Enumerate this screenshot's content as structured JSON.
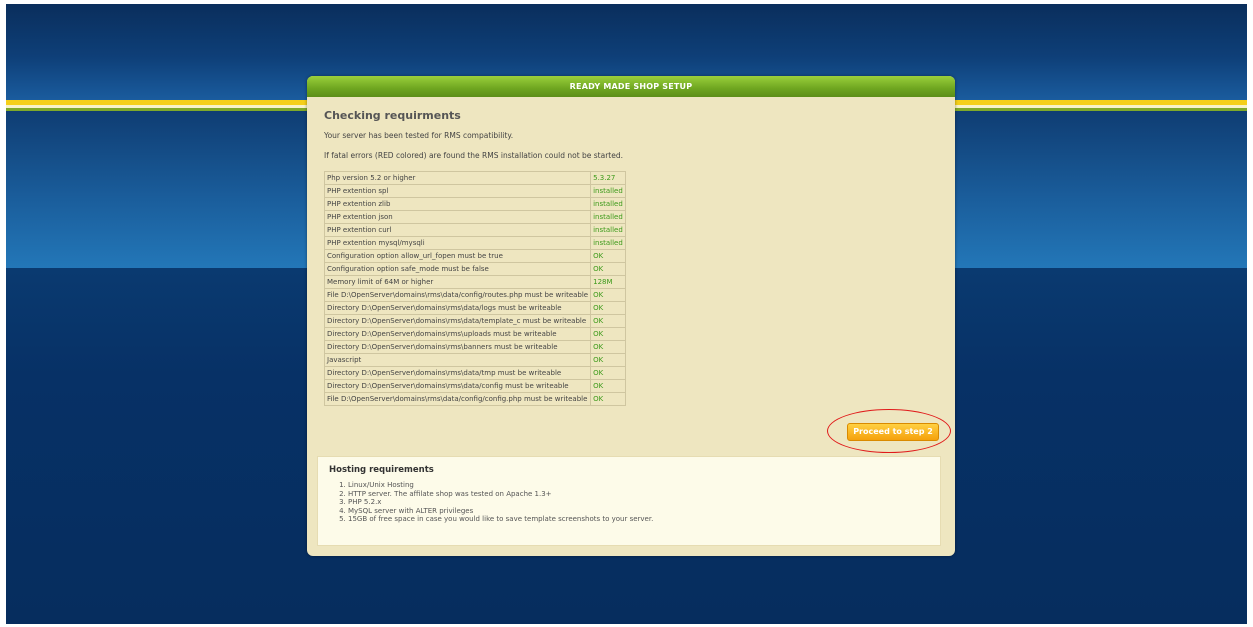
{
  "header": {
    "title": "READY MADE SHOP SETUP"
  },
  "main": {
    "title": "Checking requirments",
    "intro_1": "Your server has been tested for RMS compatibility.",
    "intro_2": "If fatal errors (RED colored) are found the RMS installation could not be started."
  },
  "requirements": [
    {
      "check": "Php version 5.2 or higher",
      "status": "5.3.27"
    },
    {
      "check": "PHP extention spl",
      "status": "installed"
    },
    {
      "check": "PHP extention zlib",
      "status": "installed"
    },
    {
      "check": "PHP extention json",
      "status": "installed"
    },
    {
      "check": "PHP extention curl",
      "status": "installed"
    },
    {
      "check": "PHP extention mysql/mysqli",
      "status": "installed"
    },
    {
      "check": "Configuration option allow_url_fopen must be true",
      "status": "OK"
    },
    {
      "check": "Configuration option safe_mode must be false",
      "status": "OK"
    },
    {
      "check": "Memory limit of 64M or higher",
      "status": "128M"
    },
    {
      "check": "File D:\\OpenServer\\domains\\rms\\data/config/routes.php must be writeable",
      "status": "OK"
    },
    {
      "check": "Directory D:\\OpenServer\\domains\\rms\\data/logs must be writeable",
      "status": "OK"
    },
    {
      "check": "Directory D:\\OpenServer\\domains\\rms\\data/template_c must be writeable",
      "status": "OK"
    },
    {
      "check": "Directory D:\\OpenServer\\domains\\rms\\uploads must be writeable",
      "status": "OK"
    },
    {
      "check": "Directory D:\\OpenServer\\domains\\rms\\banners must be writeable",
      "status": "OK"
    },
    {
      "check": "Javascript",
      "status": "OK"
    },
    {
      "check": "Directory D:\\OpenServer\\domains\\rms\\data/tmp must be writeable",
      "status": "OK"
    },
    {
      "check": "Directory D:\\OpenServer\\domains\\rms\\data/config must be writeable",
      "status": "OK"
    },
    {
      "check": "File D:\\OpenServer\\domains\\rms\\data/config/config.php must be writeable",
      "status": "OK"
    }
  ],
  "proceed_button": {
    "label": "Proceed to step 2"
  },
  "hosting": {
    "title": "Hosting requirements",
    "items": [
      "Linux/Unix Hosting",
      "HTTP server. The affilate shop was tested on Apache 1.3+",
      "PHP 5.2.x",
      "MySQL server with ALTER privileges",
      "15GB of free space in case you would like to save template screenshots to your server."
    ]
  },
  "colors": {
    "background_dark": "#062d5e",
    "header_green": "#6ea520",
    "panel_bg": "#eee6c0",
    "ok_green": "#3c9a1a",
    "button_orange": "#f5a10c",
    "highlight_red": "#e01a1a"
  }
}
